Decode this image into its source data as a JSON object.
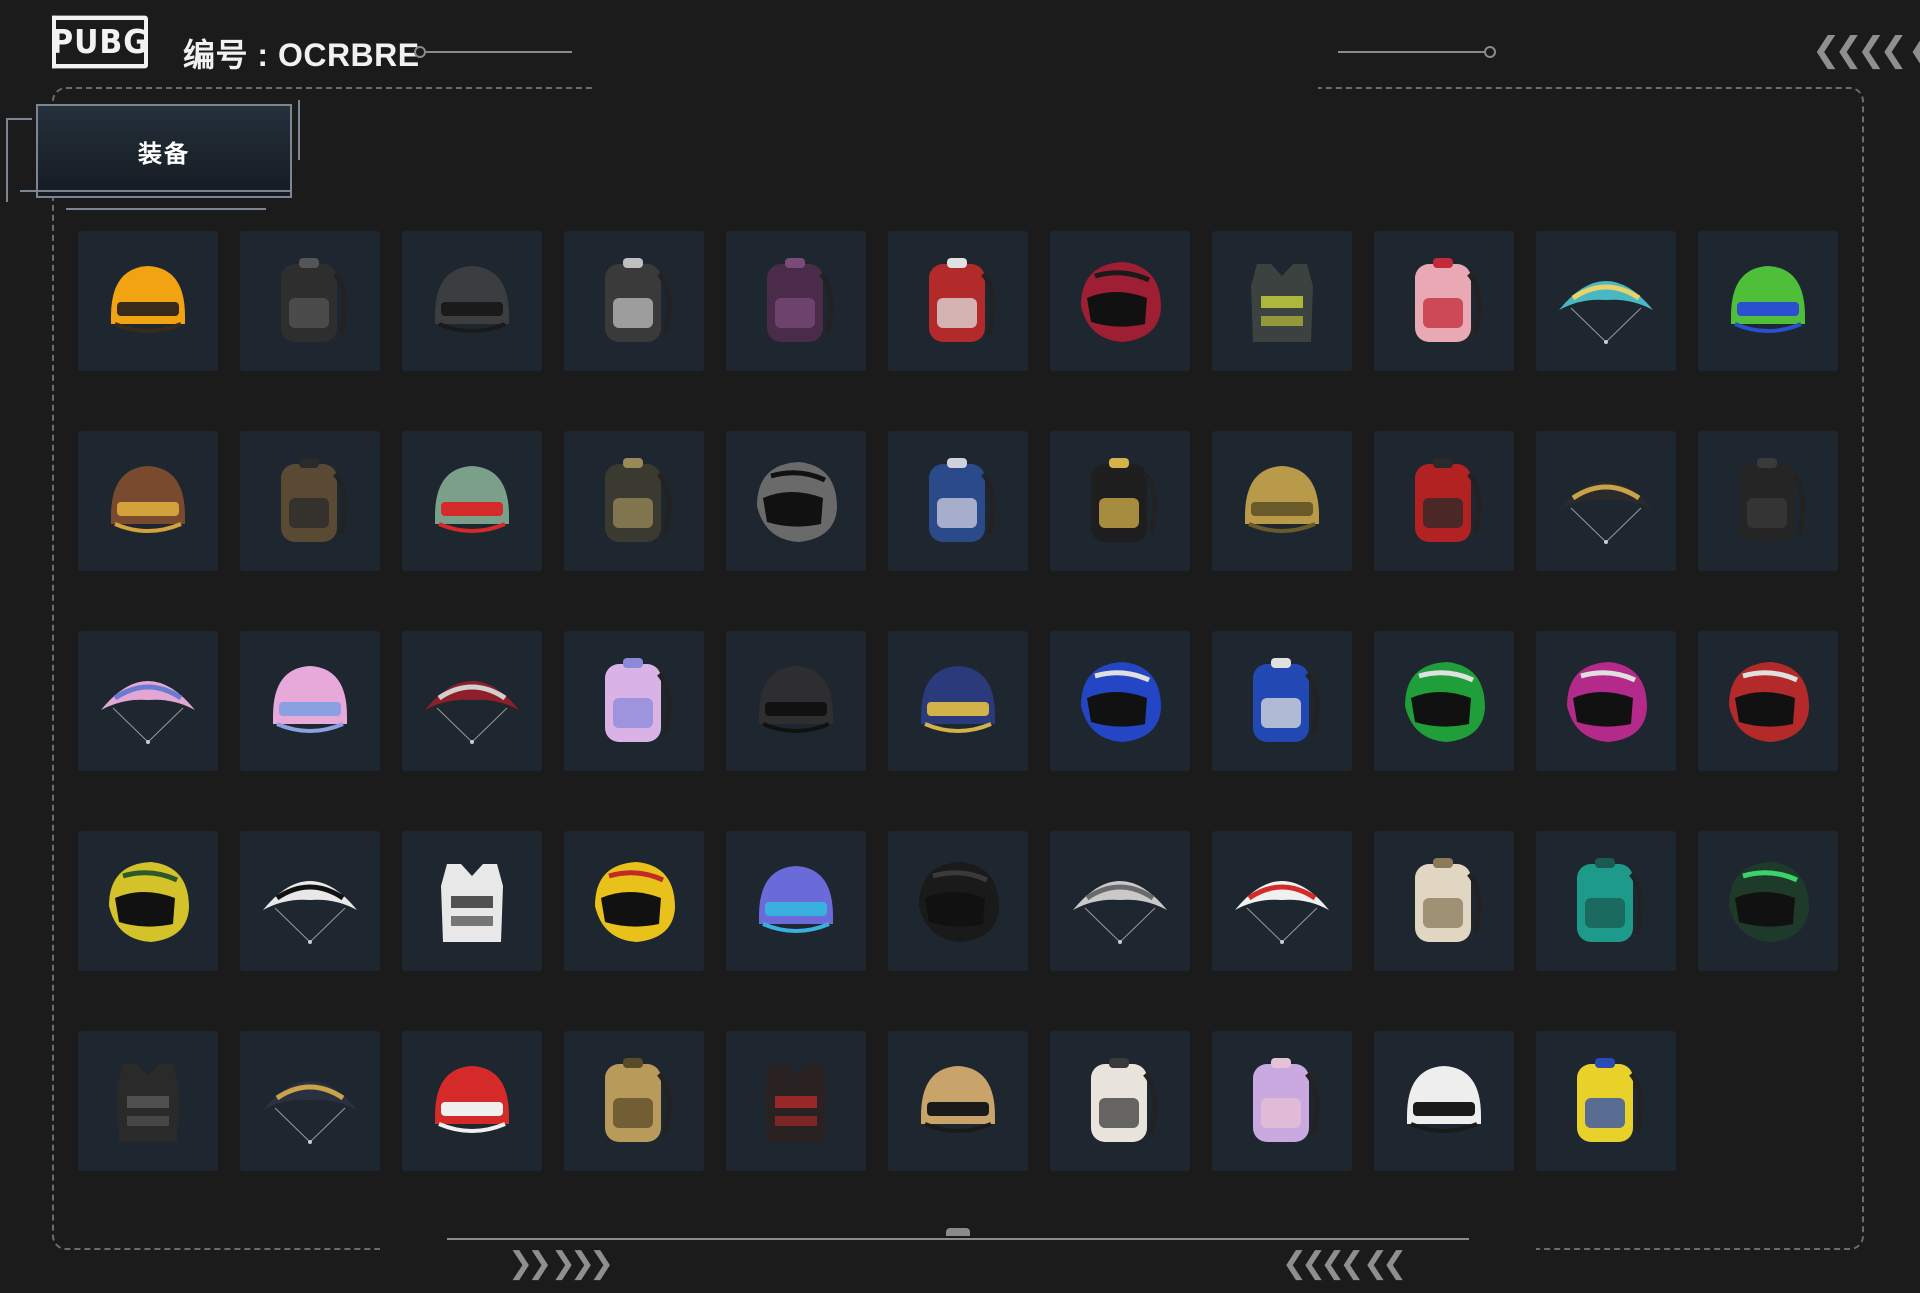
{
  "header": {
    "logo_text": "PUBG",
    "serial_label": "编号 : OCRBRE"
  },
  "tab": {
    "label": "装备"
  },
  "equipment": [
    {
      "name": "helmet-propeller",
      "kind": "helmet",
      "color": "#f2a312",
      "accent": "#3a2a1a"
    },
    {
      "name": "backpack-black",
      "kind": "backpack",
      "color": "#2e2e2e",
      "accent": "#555555"
    },
    {
      "name": "helmet-iron",
      "kind": "helmet",
      "color": "#3b3d40",
      "accent": "#1a1a1a"
    },
    {
      "name": "backpack-camo-bw",
      "kind": "backpack",
      "color": "#3a3a3a",
      "accent": "#bfbfbf"
    },
    {
      "name": "backpack-crystal-purple",
      "kind": "backpack",
      "color": "#4a2c4a",
      "accent": "#7a4a7a"
    },
    {
      "name": "backpack-red-white",
      "kind": "backpack",
      "color": "#b22a2a",
      "accent": "#e0e0e0"
    },
    {
      "name": "helmet-red-moto",
      "kind": "moto",
      "color": "#9e1f33",
      "accent": "#1a1a1a"
    },
    {
      "name": "vest-camo-yellow",
      "kind": "vest",
      "color": "#3c4240",
      "accent": "#c9d43a"
    },
    {
      "name": "backpack-donut-pink",
      "kind": "backpack",
      "color": "#e9a9b4",
      "accent": "#c22a3a"
    },
    {
      "name": "parachute-teal",
      "kind": "parachute",
      "color": "#49b8c2",
      "accent": "#e8d36a"
    },
    {
      "name": "helmet-diver-green",
      "kind": "helmet",
      "color": "#4fbf3a",
      "accent": "#2a4fd1"
    },
    {
      "name": "helmet-reindeer",
      "kind": "helmet",
      "color": "#7a4a2e",
      "accent": "#d4a23a"
    },
    {
      "name": "backpack-leopard-51",
      "kind": "backpack",
      "color": "#5a4a34",
      "accent": "#2a2a2a"
    },
    {
      "name": "helmet-devil-green",
      "kind": "helmet",
      "color": "#7aa08a",
      "accent": "#d42a2a"
    },
    {
      "name": "backpack-dark-camo",
      "kind": "backpack",
      "color": "#3a3a30",
      "accent": "#9a8a5a"
    },
    {
      "name": "helmet-gray-visor",
      "kind": "moto",
      "color": "#6a6a6a",
      "accent": "#111111"
    },
    {
      "name": "backpack-stars-blue",
      "kind": "backpack",
      "color": "#2a4a8a",
      "accent": "#d0d0e0"
    },
    {
      "name": "backpack-gold-black",
      "kind": "backpack",
      "color": "#1e1e1e",
      "accent": "#d4b24a"
    },
    {
      "name": "helmet-gold-spartan",
      "kind": "helmet",
      "color": "#b99a4a",
      "accent": "#6a5a2a"
    },
    {
      "name": "backpack-red-tactical",
      "kind": "backpack",
      "color": "#b22222",
      "accent": "#2a2a2a"
    },
    {
      "name": "parachute-gold-black",
      "kind": "parachute",
      "color": "#2a2a2a",
      "accent": "#c9a24a"
    },
    {
      "name": "backpack-black-plain",
      "kind": "backpack",
      "color": "#252525",
      "accent": "#3a3a3a"
    },
    {
      "name": "parachute-pink",
      "kind": "parachute",
      "color": "#e3a7d6",
      "accent": "#6a7ad1"
    },
    {
      "name": "helmet-pink-horns",
      "kind": "helmet",
      "color": "#e6a9d9",
      "accent": "#8aa0e0"
    },
    {
      "name": "parachute-red-swirl",
      "kind": "parachute",
      "color": "#8e1f2a",
      "accent": "#d0d0d0"
    },
    {
      "name": "backpack-pink-lilac",
      "kind": "backpack",
      "color": "#d9b2e6",
      "accent": "#8a8ad9"
    },
    {
      "name": "helmet-black-carbon",
      "kind": "helmet",
      "color": "#2e2e30",
      "accent": "#111111"
    },
    {
      "name": "helmet-blue-gold",
      "kind": "helmet",
      "color": "#2a3a7a",
      "accent": "#d4b24a"
    },
    {
      "name": "helmet-blue-moto",
      "kind": "moto",
      "color": "#2446c4",
      "accent": "#e0e0e0"
    },
    {
      "name": "backpack-blue",
      "kind": "backpack",
      "color": "#2248b4",
      "accent": "#e0e0e0"
    },
    {
      "name": "helmet-green-moto",
      "kind": "moto",
      "color": "#1f9e3a",
      "accent": "#e0e0e0"
    },
    {
      "name": "helmet-magenta-moto",
      "kind": "moto",
      "color": "#b42a8a",
      "accent": "#e0e0e0"
    },
    {
      "name": "helmet-red-moto-2",
      "kind": "moto",
      "color": "#b42a2a",
      "accent": "#e0e0e0"
    },
    {
      "name": "helmet-yellow-moto",
      "kind": "moto",
      "color": "#d4c22a",
      "accent": "#2a5a2a"
    },
    {
      "name": "parachute-bw-script",
      "kind": "parachute",
      "color": "#e8e8e8",
      "accent": "#111111"
    },
    {
      "name": "vest-white-graffiti",
      "kind": "vest",
      "color": "#e8e8e8",
      "accent": "#2a2a2a"
    },
    {
      "name": "helmet-cat-rainbow",
      "kind": "moto",
      "color": "#e8c21a",
      "accent": "#c22a2a"
    },
    {
      "name": "helmet-purple-pixel",
      "kind": "helmet",
      "color": "#6a6ad9",
      "accent": "#3ab0e0"
    },
    {
      "name": "helmet-black-moto",
      "kind": "moto",
      "color": "#1a1a1a",
      "accent": "#3a3a3a"
    },
    {
      "name": "parachute-gray-pattern",
      "kind": "parachute",
      "color": "#c9c9c9",
      "accent": "#6a6a6a"
    },
    {
      "name": "parachute-kfc",
      "kind": "parachute",
      "color": "#f0f0f0",
      "accent": "#d42a2a"
    },
    {
      "name": "backpack-cream",
      "kind": "backpack",
      "color": "#e0d6c2",
      "accent": "#8a7a5a"
    },
    {
      "name": "backpack-teal",
      "kind": "backpack",
      "color": "#1e9a8a",
      "accent": "#1a5a50"
    },
    {
      "name": "helmet-dark-green-moto",
      "kind": "moto",
      "color": "#1e3a2a",
      "accent": "#3ad46a"
    },
    {
      "name": "vest-black-tactical",
      "kind": "vest",
      "color": "#2a2a2a",
      "accent": "#5a5a5a"
    },
    {
      "name": "parachute-navy-gold",
      "kind": "parachute",
      "color": "#2a3040",
      "accent": "#c9a24a"
    },
    {
      "name": "helmet-jester",
      "kind": "helmet",
      "color": "#d42a2a",
      "accent": "#f0f0f0"
    },
    {
      "name": "backpack-tan",
      "kind": "backpack",
      "color": "#b89a5a",
      "accent": "#5a4a2a"
    },
    {
      "name": "vest-black-red",
      "kind": "vest",
      "color": "#2a2222",
      "accent": "#b42a2a"
    },
    {
      "name": "helmet-tan-level3",
      "kind": "helmet",
      "color": "#c9a46a",
      "accent": "#1a1a1a"
    },
    {
      "name": "backpack-white-floral",
      "kind": "backpack",
      "color": "#e8e4dc",
      "accent": "#3a3a3a"
    },
    {
      "name": "backpack-lavender-cute",
      "kind": "backpack",
      "color": "#c9a9e0",
      "accent": "#e6c2d6"
    },
    {
      "name": "helmet-dalmatian",
      "kind": "helmet",
      "color": "#eeeeee",
      "accent": "#1a1a1a"
    },
    {
      "name": "backpack-yellow-blue",
      "kind": "backpack",
      "color": "#e8d22a",
      "accent": "#2a4ab4"
    }
  ]
}
